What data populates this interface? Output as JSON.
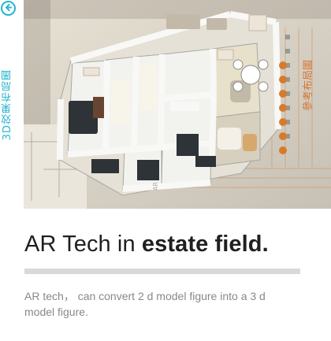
{
  "sidebar": {
    "back_icon": "circle-arrow-left-icon",
    "vertical_label": "3D效果布局圖",
    "accent_color": "#27b5cf"
  },
  "hero": {
    "image_subject": "3d-floor-plan-model",
    "overlay_text": "參考布局圖"
  },
  "article": {
    "headline_part1": "AR Tech in ",
    "headline_emph": "estate field.",
    "description": "AR tech， can convert 2 d model figure into a 3 d model figure."
  },
  "colors": {
    "headline": "#1f1f1f",
    "description": "#888888",
    "rule": "#d9d9d9"
  }
}
